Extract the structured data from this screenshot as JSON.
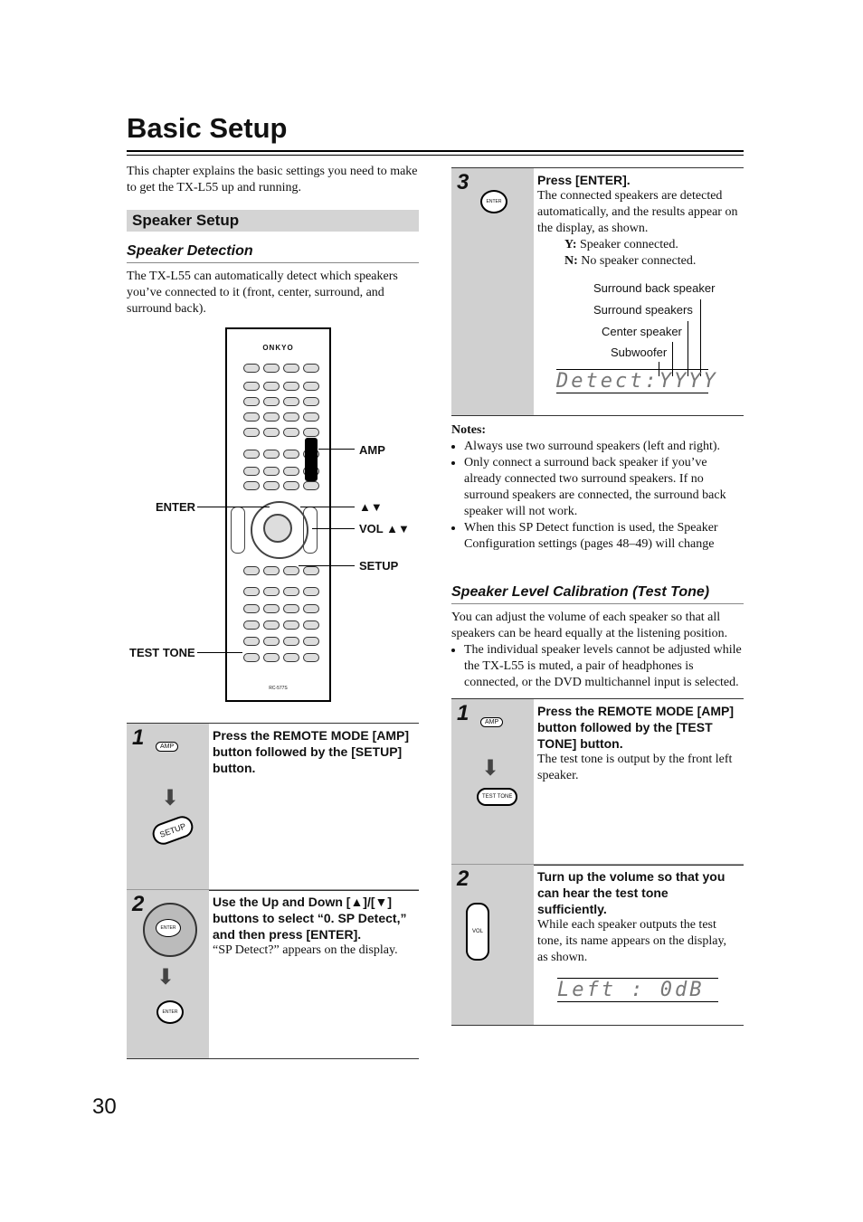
{
  "title": "Basic Setup",
  "intro": "This chapter explains the basic settings you need to make to get the TX-L55 up and running.",
  "section": "Speaker Setup",
  "detection": {
    "heading": "Speaker Detection",
    "text": "The TX-L55 can automatically detect which speakers you’ve connected to it (front, center, surround, and surround back)."
  },
  "remote": {
    "brand": "ONKYO",
    "model": "RC-577S",
    "callouts": {
      "amp": "AMP",
      "enter": "ENTER",
      "updown": "▲▼",
      "vol": "VOL ▲▼",
      "setup": "SETUP",
      "test_tone": "TEST TONE"
    }
  },
  "left_steps": [
    {
      "num": "1",
      "title": "Press the REMOTE MODE [AMP] button followed by the [SETUP] button.",
      "text": "",
      "icons": [
        "AMP",
        "SETUP"
      ]
    },
    {
      "num": "2",
      "title": "Use the Up and Down [▲]/[▼] buttons to select “0. SP Detect,” and then press [ENTER].",
      "text": "“SP Detect?” appears on the display.",
      "icons": [
        "ENTER",
        "ENTER"
      ]
    }
  ],
  "step3": {
    "num": "3",
    "title": "Press [ENTER].",
    "text": "The connected speakers are detected automatically, and the results appear on the display, as shown.",
    "legend": [
      {
        "k": "Y:",
        "v": "Speaker connected."
      },
      {
        "k": "N:",
        "v": "No speaker connected."
      }
    ],
    "labels": [
      "Surround back speaker",
      "Surround speakers",
      "Center speaker",
      "Subwoofer"
    ],
    "display": "Detect:YYYY",
    "icon": "ENTER"
  },
  "notes": {
    "heading": "Notes:",
    "items": [
      "Always use two surround speakers (left and right).",
      "Only connect a surround back speaker if you’ve already connected two surround speakers. If no surround speakers are connected, the surround back speaker will not work.",
      "When this SP Detect function is used, the Speaker Configuration settings (pages 48–49) will change"
    ]
  },
  "calibration": {
    "heading": "Speaker Level Calibration (Test Tone)",
    "text": "You can adjust the volume of each speaker so that all speakers can be heard equally at the listening position.",
    "bullet": "The individual speaker levels cannot be adjusted while the TX-L55 is muted, a pair of headphones is connected, or the DVD multichannel input is selected."
  },
  "right_steps": [
    {
      "num": "1",
      "title": "Press the REMOTE MODE [AMP] button followed by the [TEST TONE] button.",
      "text": "The test tone is output by the front left speaker.",
      "icons": [
        "AMP",
        "TEST TONE"
      ]
    },
    {
      "num": "2",
      "title": "Turn up the volume so that you can hear the test tone sufficiently.",
      "text": "While each speaker outputs the test tone, its name appears on the display, as shown.",
      "display": "Left : 0dB",
      "icons": [
        "VOL"
      ]
    }
  ],
  "page_number": "30"
}
